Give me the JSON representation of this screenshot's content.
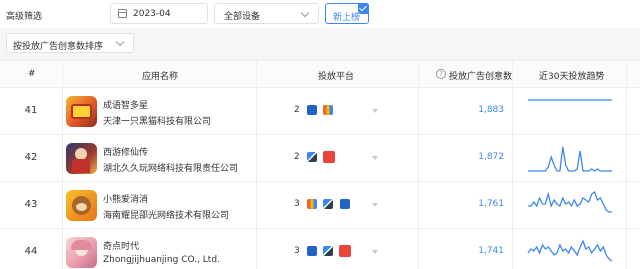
{
  "filters": {
    "label": "高级筛选",
    "date": "2023-04",
    "device": "全部设备",
    "new_listing": "新上榜"
  },
  "sort": {
    "label": "按投放广告创意数排序"
  },
  "columns": {
    "rank": "#",
    "app": "应用名称",
    "platform": "投放平台",
    "ads": "投放广告创意数",
    "trend": "近30天投放趋势"
  },
  "rows": [
    {
      "rank": "41",
      "name": "成语智多星",
      "company": "天津一只黑猫科技有限公司",
      "platform_count": "2",
      "platforms": [
        "blue-square-icon",
        "tricolor-stripes-icon"
      ],
      "ads": "1,883",
      "trend": [
        12,
        12,
        12,
        12,
        12,
        12,
        12,
        12,
        12,
        12,
        12,
        12,
        12,
        12,
        12,
        12,
        12,
        12,
        12,
        12,
        12,
        12,
        12,
        12,
        12,
        12,
        12,
        12,
        12,
        12
      ]
    },
    {
      "rank": "42",
      "name": "西游修仙传",
      "company": "湖北久久玩网络科技有限责任公司",
      "platform_count": "2",
      "platforms": [
        "wave-icon",
        "red-badge-icon"
      ],
      "ads": "1,872",
      "trend": [
        0,
        0,
        0,
        0,
        0,
        0,
        0,
        2,
        7,
        3,
        0,
        0,
        12,
        3,
        0,
        0,
        0,
        1,
        10,
        0,
        0,
        0,
        1,
        0,
        1,
        0,
        0,
        0,
        0,
        0
      ]
    },
    {
      "rank": "43",
      "name": "小熊爱消消",
      "company": "海南耀昆邵光网络技术有限公司",
      "platform_count": "3",
      "platforms": [
        "tricolor-stripes-icon",
        "wave-icon",
        "blue-square-icon"
      ],
      "ads": "1,761",
      "trend": [
        6,
        6,
        8,
        6,
        10,
        7,
        7,
        12,
        6,
        9,
        7,
        6,
        10,
        7,
        8,
        6,
        9,
        6,
        7,
        10,
        9,
        8,
        12,
        13,
        9,
        10,
        7,
        4,
        3,
        3
      ]
    },
    {
      "rank": "44",
      "name": "奇点时代",
      "company": "Zhongjijhuanjing CO., Ltd.",
      "platform_count": "3",
      "platforms": [
        "blue-square-icon",
        "wave-icon",
        "red-badge-icon"
      ],
      "ads": "1,741",
      "trend": [
        6,
        8,
        7,
        9,
        6,
        10,
        8,
        9,
        7,
        5,
        6,
        10,
        7,
        8,
        6,
        9,
        7,
        5,
        9,
        12,
        8,
        9,
        6,
        8,
        10,
        7,
        9,
        5,
        3,
        2
      ]
    }
  ],
  "colors": {
    "accent": "#3b86f3",
    "trend_line": "#3b86f3",
    "platform_blue": "#1f63c9",
    "platform_red": "#e8453c"
  }
}
